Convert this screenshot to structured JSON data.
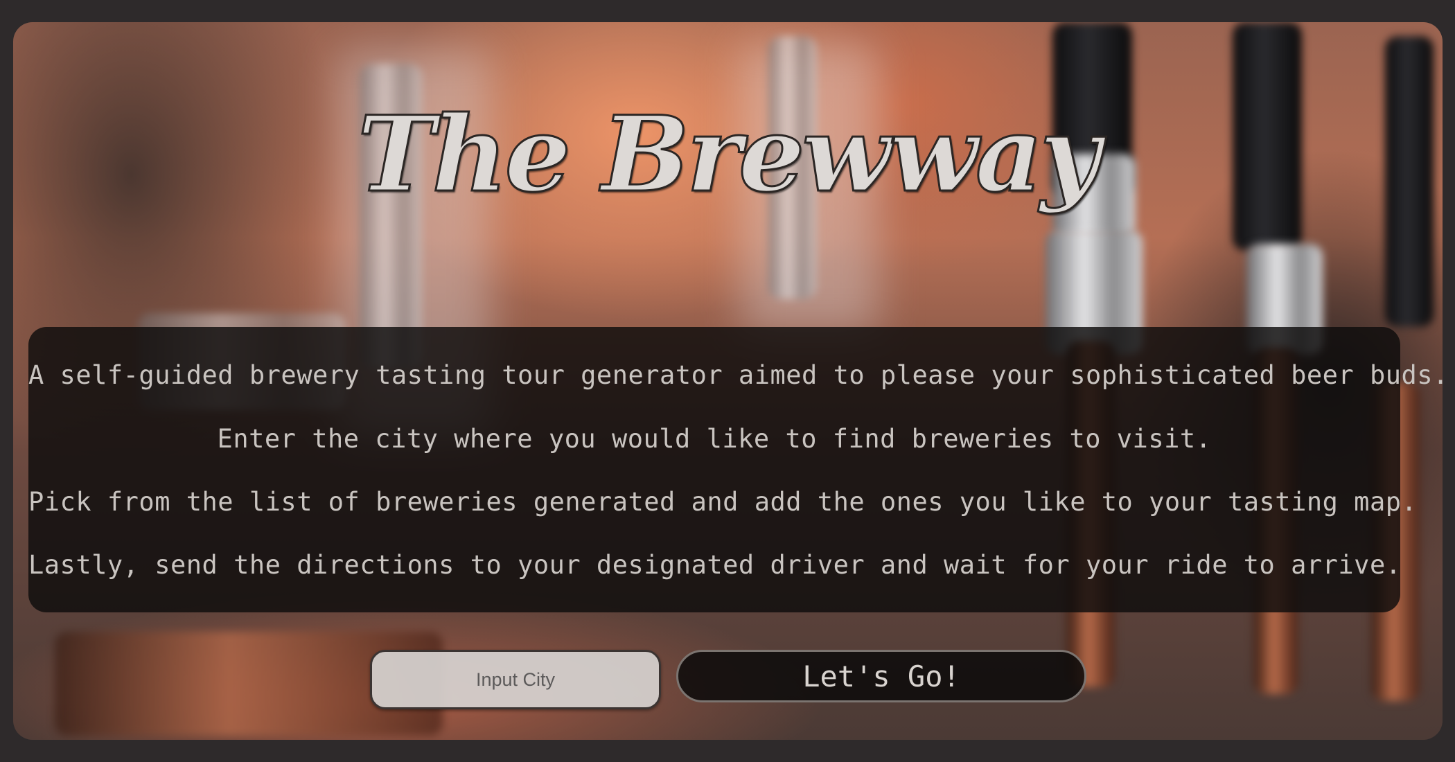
{
  "hero": {
    "title": "The Brewway"
  },
  "intro": {
    "lines": [
      "A self-guided brewery tasting tour generator aimed to please your sophisticated beer buds.",
      "Enter the city where you would like to find breweries to visit.",
      "Pick from the list of breweries generated and add the ones you like to your tasting map.",
      "Lastly, send the directions to your designated driver and wait for your ride to arrive."
    ]
  },
  "search": {
    "placeholder": "Input City",
    "value": "",
    "button_label": "Let's Go!"
  },
  "colors": {
    "page_border": "#2e2a2b",
    "panel_background": "#0e0c0c",
    "text": "#c9c4c0"
  }
}
